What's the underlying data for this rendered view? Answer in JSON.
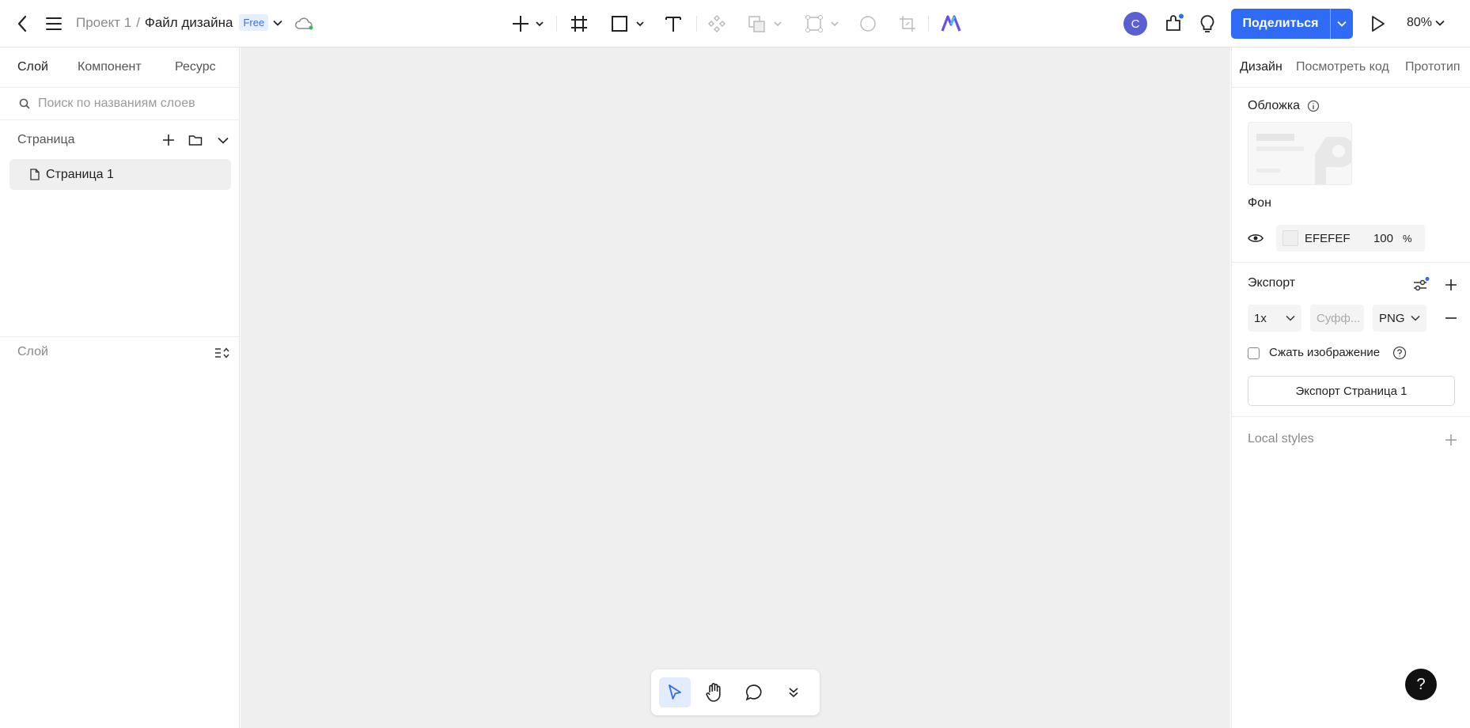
{
  "header": {
    "project": "Проект 1",
    "separator": "/",
    "file_name": "Файл дизайна",
    "plan_badge": "Free",
    "avatar_letter": "C",
    "share_label": "Поделиться",
    "zoom": "80%"
  },
  "left_panel": {
    "tabs": [
      "Слой",
      "Компонент",
      "Ресурс"
    ],
    "search_placeholder": "Поиск по названиям слоев",
    "pages_title": "Страница",
    "pages": [
      "Страница 1"
    ],
    "layers_title": "Слой"
  },
  "right_panel": {
    "tabs": [
      "Дизайн",
      "Посмотреть код",
      "Прототип"
    ],
    "cover_label": "Обложка",
    "background_label": "Фон",
    "bg_hex": "EFEFEF",
    "bg_opacity": "100",
    "bg_opacity_unit": "%",
    "export_label": "Экспорт",
    "scale": "1x",
    "suffix_placeholder": "Суфф...",
    "format": "PNG",
    "compress_label": "Сжать изображение",
    "export_button": "Экспорт Страница 1",
    "local_styles": "Local styles"
  },
  "help_label": "?",
  "colors": {
    "accent": "#2f6bf5",
    "canvas": "#efefef",
    "avatar": "#5a5fd1"
  }
}
